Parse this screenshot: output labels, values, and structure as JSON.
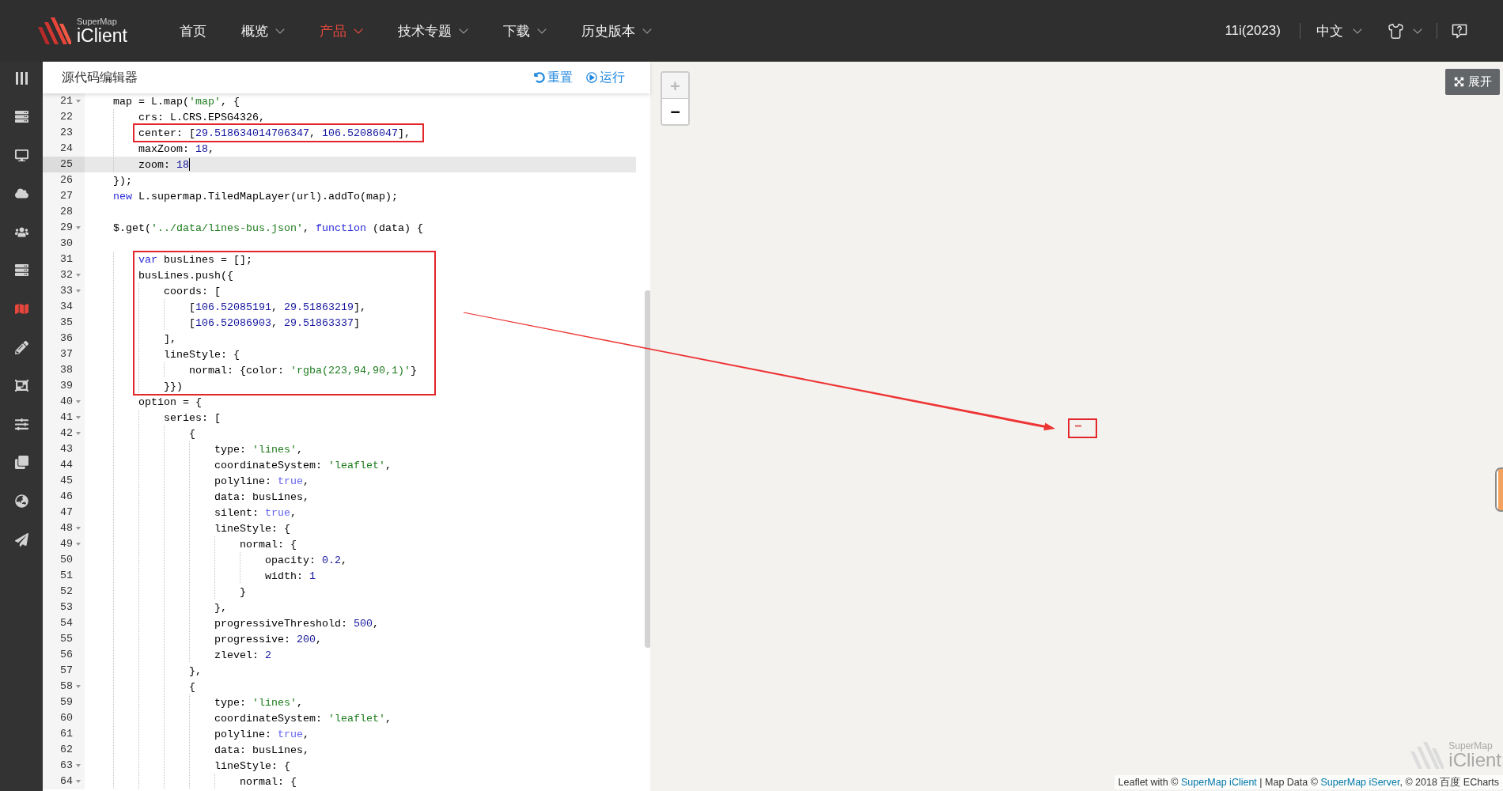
{
  "topbar": {
    "logo": {
      "brand": "SuperMap",
      "product": "iClient"
    },
    "tabs": [
      {
        "label": "首页",
        "has_menu": false,
        "selected": false
      },
      {
        "label": "概览",
        "has_menu": true,
        "selected": false
      },
      {
        "label": "产品",
        "has_menu": true,
        "selected": true
      },
      {
        "label": "技术专题",
        "has_menu": true,
        "selected": false
      },
      {
        "label": "下载",
        "has_menu": true,
        "selected": false
      },
      {
        "label": "历史版本",
        "has_menu": true,
        "selected": false
      }
    ],
    "version": "11i(2023)",
    "language": "中文"
  },
  "sidebar": {
    "items": [
      {
        "kind": "columns",
        "selected": false
      },
      {
        "kind": "server",
        "selected": false
      },
      {
        "kind": "desktop",
        "selected": false
      },
      {
        "kind": "cloud",
        "selected": false
      },
      {
        "kind": "users",
        "selected": false
      },
      {
        "kind": "server",
        "selected": false
      },
      {
        "kind": "map",
        "selected": true
      },
      {
        "kind": "pencil",
        "selected": false
      },
      {
        "kind": "frame",
        "selected": false
      },
      {
        "kind": "sliders",
        "selected": false
      },
      {
        "kind": "clone",
        "selected": false
      },
      {
        "kind": "globe",
        "selected": false
      },
      {
        "kind": "plane",
        "selected": false
      }
    ]
  },
  "editor": {
    "title": "源代码编辑器",
    "actions": [
      {
        "kind": "reset",
        "label": "重置"
      },
      {
        "kind": "run",
        "label": "运行"
      }
    ],
    "lines": [
      {
        "number": "21",
        "foldable": true,
        "active": false,
        "tokens": [
          {
            "kind": "plain",
            "text": "    map = L.map("
          },
          {
            "kind": "string",
            "text": "'map'"
          },
          {
            "kind": "plain",
            "text": ", {"
          }
        ]
      },
      {
        "number": "22",
        "foldable": false,
        "active": false,
        "tokens": [
          {
            "kind": "plain",
            "text": "        crs: L.CRS.EPSG4326,"
          }
        ]
      },
      {
        "number": "23",
        "foldable": false,
        "active": false,
        "tokens": [
          {
            "kind": "plain",
            "text": "        center: ["
          },
          {
            "kind": "number",
            "text": "29.518634014706347"
          },
          {
            "kind": "plain",
            "text": ", "
          },
          {
            "kind": "number",
            "text": "106.52086047"
          },
          {
            "kind": "plain",
            "text": "],"
          }
        ]
      },
      {
        "number": "24",
        "foldable": false,
        "active": false,
        "tokens": [
          {
            "kind": "plain",
            "text": "        maxZoom: "
          },
          {
            "kind": "number",
            "text": "18"
          },
          {
            "kind": "plain",
            "text": ","
          }
        ]
      },
      {
        "number": "25",
        "foldable": false,
        "active": true,
        "tokens": [
          {
            "kind": "plain",
            "text": "        zoom: "
          },
          {
            "kind": "number",
            "text": "18"
          }
        ]
      },
      {
        "number": "26",
        "foldable": false,
        "active": false,
        "tokens": [
          {
            "kind": "plain",
            "text": "    });"
          }
        ]
      },
      {
        "number": "27",
        "foldable": false,
        "active": false,
        "tokens": [
          {
            "kind": "keyword",
            "text": "    new"
          },
          {
            "kind": "plain",
            "text": " L.supermap.TiledMapLayer(url).addTo(map);"
          }
        ]
      },
      {
        "number": "28",
        "foldable": false,
        "active": false
      },
      {
        "number": "29",
        "foldable": true,
        "active": false,
        "tokens": [
          {
            "kind": "plain",
            "text": "    $.get("
          },
          {
            "kind": "string",
            "text": "'../data/lines-bus.json'"
          },
          {
            "kind": "plain",
            "text": ", "
          },
          {
            "kind": "keyword",
            "text": "function"
          },
          {
            "kind": "plain",
            "text": " (data) {"
          }
        ]
      },
      {
        "number": "30",
        "foldable": false,
        "active": false
      },
      {
        "number": "31",
        "foldable": false,
        "active": false,
        "tokens": [
          {
            "kind": "keyword",
            "text": "        var"
          },
          {
            "kind": "plain",
            "text": " busLines = [];"
          }
        ]
      },
      {
        "number": "32",
        "foldable": true,
        "active": false,
        "tokens": [
          {
            "kind": "plain",
            "text": "        busLines.push({"
          }
        ]
      },
      {
        "number": "33",
        "foldable": true,
        "active": false,
        "tokens": [
          {
            "kind": "plain",
            "text": "            coords: ["
          }
        ]
      },
      {
        "number": "34",
        "foldable": false,
        "active": false,
        "tokens": [
          {
            "kind": "plain",
            "text": "                ["
          },
          {
            "kind": "number",
            "text": "106.52085191"
          },
          {
            "kind": "plain",
            "text": ", "
          },
          {
            "kind": "number",
            "text": "29.51863219"
          },
          {
            "kind": "plain",
            "text": "],"
          }
        ]
      },
      {
        "number": "35",
        "foldable": false,
        "active": false,
        "tokens": [
          {
            "kind": "plain",
            "text": "                ["
          },
          {
            "kind": "number",
            "text": "106.52086903"
          },
          {
            "kind": "plain",
            "text": ", "
          },
          {
            "kind": "number",
            "text": "29.51863337"
          },
          {
            "kind": "plain",
            "text": "]"
          }
        ]
      },
      {
        "number": "36",
        "foldable": false,
        "active": false,
        "tokens": [
          {
            "kind": "plain",
            "text": "            ],"
          }
        ]
      },
      {
        "number": "37",
        "foldable": false,
        "active": false,
        "tokens": [
          {
            "kind": "plain",
            "text": "            lineStyle: {"
          }
        ]
      },
      {
        "number": "38",
        "foldable": false,
        "active": false,
        "tokens": [
          {
            "kind": "plain",
            "text": "                normal: {color: "
          },
          {
            "kind": "string",
            "text": "'rgba(223,94,90,1)'"
          },
          {
            "kind": "plain",
            "text": "}"
          }
        ]
      },
      {
        "number": "39",
        "foldable": false,
        "active": false,
        "tokens": [
          {
            "kind": "plain",
            "text": "            }})"
          }
        ]
      },
      {
        "number": "40",
        "foldable": true,
        "active": false,
        "tokens": [
          {
            "kind": "plain",
            "text": "        option = {"
          }
        ]
      },
      {
        "number": "41",
        "foldable": true,
        "active": false,
        "tokens": [
          {
            "kind": "plain",
            "text": "            series: ["
          }
        ]
      },
      {
        "number": "42",
        "foldable": true,
        "active": false,
        "tokens": [
          {
            "kind": "plain",
            "text": "                {"
          }
        ]
      },
      {
        "number": "43",
        "foldable": false,
        "active": false,
        "tokens": [
          {
            "kind": "plain",
            "text": "                    type: "
          },
          {
            "kind": "string",
            "text": "'lines'"
          },
          {
            "kind": "plain",
            "text": ","
          }
        ]
      },
      {
        "number": "44",
        "foldable": false,
        "active": false,
        "tokens": [
          {
            "kind": "plain",
            "text": "                    coordinateSystem: "
          },
          {
            "kind": "string",
            "text": "'leaflet'"
          },
          {
            "kind": "plain",
            "text": ","
          }
        ]
      },
      {
        "number": "45",
        "foldable": false,
        "active": false,
        "tokens": [
          {
            "kind": "plain",
            "text": "                    polyline: "
          },
          {
            "kind": "atom",
            "text": "true"
          },
          {
            "kind": "plain",
            "text": ","
          }
        ]
      },
      {
        "number": "46",
        "foldable": false,
        "active": false,
        "tokens": [
          {
            "kind": "plain",
            "text": "                    data: busLines,"
          }
        ]
      },
      {
        "number": "47",
        "foldable": false,
        "active": false,
        "tokens": [
          {
            "kind": "plain",
            "text": "                    silent: "
          },
          {
            "kind": "atom",
            "text": "true"
          },
          {
            "kind": "plain",
            "text": ","
          }
        ]
      },
      {
        "number": "48",
        "foldable": true,
        "active": false,
        "tokens": [
          {
            "kind": "plain",
            "text": "                    lineStyle: {"
          }
        ]
      },
      {
        "number": "49",
        "foldable": true,
        "active": false,
        "tokens": [
          {
            "kind": "plain",
            "text": "                        normal: {"
          }
        ]
      },
      {
        "number": "50",
        "foldable": false,
        "active": false,
        "tokens": [
          {
            "kind": "plain",
            "text": "                            opacity: "
          },
          {
            "kind": "number",
            "text": "0.2"
          },
          {
            "kind": "plain",
            "text": ","
          }
        ]
      },
      {
        "number": "51",
        "foldable": false,
        "active": false,
        "tokens": [
          {
            "kind": "plain",
            "text": "                            width: "
          },
          {
            "kind": "number",
            "text": "1"
          }
        ]
      },
      {
        "number": "52",
        "foldable": false,
        "active": false,
        "tokens": [
          {
            "kind": "plain",
            "text": "                        }"
          }
        ]
      },
      {
        "number": "53",
        "foldable": false,
        "active": false,
        "tokens": [
          {
            "kind": "plain",
            "text": "                    },"
          }
        ]
      },
      {
        "number": "54",
        "foldable": false,
        "active": false,
        "tokens": [
          {
            "kind": "plain",
            "text": "                    progressiveThreshold: "
          },
          {
            "kind": "number",
            "text": "500"
          },
          {
            "kind": "plain",
            "text": ","
          }
        ]
      },
      {
        "number": "55",
        "foldable": false,
        "active": false,
        "tokens": [
          {
            "kind": "plain",
            "text": "                    progressive: "
          },
          {
            "kind": "number",
            "text": "200"
          },
          {
            "kind": "plain",
            "text": ","
          }
        ]
      },
      {
        "number": "56",
        "foldable": false,
        "active": false,
        "tokens": [
          {
            "kind": "plain",
            "text": "                    zlevel: "
          },
          {
            "kind": "number",
            "text": "2"
          }
        ]
      },
      {
        "number": "57",
        "foldable": false,
        "active": false,
        "tokens": [
          {
            "kind": "plain",
            "text": "                },"
          }
        ]
      },
      {
        "number": "58",
        "foldable": true,
        "active": false,
        "tokens": [
          {
            "kind": "plain",
            "text": "                {"
          }
        ]
      },
      {
        "number": "59",
        "foldable": false,
        "active": false,
        "tokens": [
          {
            "kind": "plain",
            "text": "                    type: "
          },
          {
            "kind": "string",
            "text": "'lines'"
          },
          {
            "kind": "plain",
            "text": ","
          }
        ]
      },
      {
        "number": "60",
        "foldable": false,
        "active": false,
        "tokens": [
          {
            "kind": "plain",
            "text": "                    coordinateSystem: "
          },
          {
            "kind": "string",
            "text": "'leaflet'"
          },
          {
            "kind": "plain",
            "text": ","
          }
        ]
      },
      {
        "number": "61",
        "foldable": false,
        "active": false,
        "tokens": [
          {
            "kind": "plain",
            "text": "                    polyline: "
          },
          {
            "kind": "atom",
            "text": "true"
          },
          {
            "kind": "plain",
            "text": ","
          }
        ]
      },
      {
        "number": "62",
        "foldable": false,
        "active": false,
        "tokens": [
          {
            "kind": "plain",
            "text": "                    data: busLines,"
          }
        ]
      },
      {
        "number": "63",
        "foldable": true,
        "active": false,
        "tokens": [
          {
            "kind": "plain",
            "text": "                    lineStyle: {"
          }
        ]
      },
      {
        "number": "64",
        "foldable": true,
        "active": false,
        "tokens": [
          {
            "kind": "plain",
            "text": "                        normal: {"
          }
        ]
      }
    ]
  },
  "map": {
    "zoom_in": {
      "label": "+",
      "disabled": true
    },
    "zoom_out": {
      "label": "−",
      "disabled": false
    },
    "expand_button": "展开",
    "logo": {
      "brand": "SuperMap",
      "product": "iClient"
    },
    "attribution": [
      {
        "kind": "text",
        "text": "Leaflet with © "
      },
      {
        "kind": "link",
        "text": "SuperMap iClient"
      },
      {
        "kind": "text",
        "text": " | Map Data © "
      },
      {
        "kind": "link",
        "text": "SuperMap iServer"
      },
      {
        "kind": "text",
        "text": ", © 2018 百度 ECharts"
      }
    ]
  }
}
